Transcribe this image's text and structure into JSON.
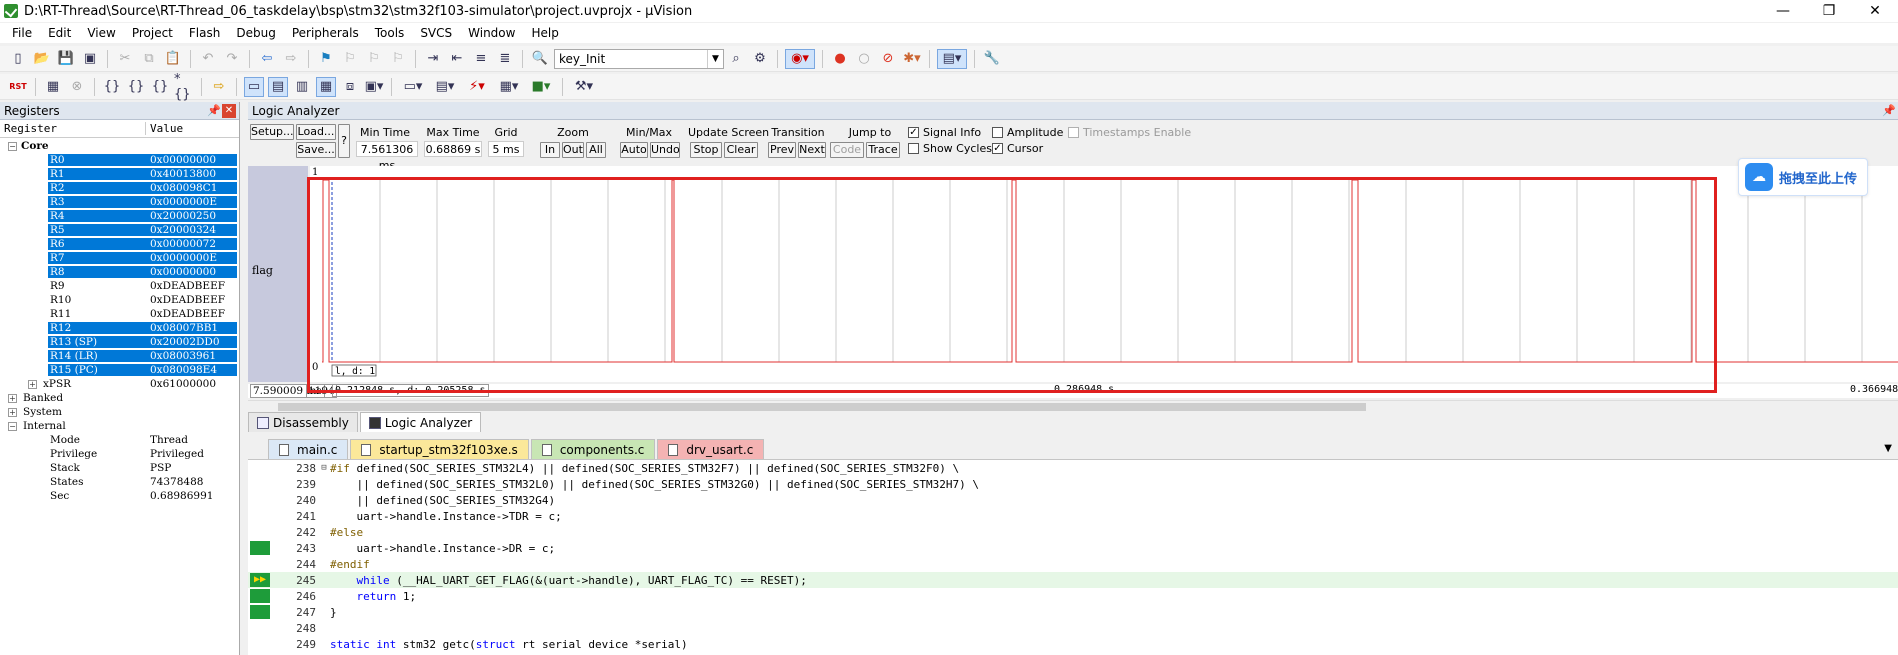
{
  "window": {
    "title": "D:\\RT-Thread\\Source\\RT-Thread_06_taskdelay\\bsp\\stm32\\stm32f103-simulator\\project.uvprojx - µVision",
    "min": "—",
    "max": "❐",
    "close": "✕"
  },
  "menu": [
    "File",
    "Edit",
    "View",
    "Project",
    "Flash",
    "Debug",
    "Peripherals",
    "Tools",
    "SVCS",
    "Window",
    "Help"
  ],
  "toolbar": {
    "target_combo": "key_Init"
  },
  "registers": {
    "title": "Registers",
    "col_register": "Register",
    "col_value": "Value",
    "core_label": "Core",
    "rows": [
      {
        "name": "R0",
        "value": "0x00000000",
        "sel": true
      },
      {
        "name": "R1",
        "value": "0x40013800",
        "sel": true
      },
      {
        "name": "R2",
        "value": "0x080098C1",
        "sel": true
      },
      {
        "name": "R3",
        "value": "0x0000000E",
        "sel": true
      },
      {
        "name": "R4",
        "value": "0x20000250",
        "sel": true
      },
      {
        "name": "R5",
        "value": "0x20000324",
        "sel": true
      },
      {
        "name": "R6",
        "value": "0x00000072",
        "sel": true
      },
      {
        "name": "R7",
        "value": "0x0000000E",
        "sel": true
      },
      {
        "name": "R8",
        "value": "0x00000000",
        "sel": true
      },
      {
        "name": "R9",
        "value": "0xDEADBEEF",
        "sel": false
      },
      {
        "name": "R10",
        "value": "0xDEADBEEF",
        "sel": false
      },
      {
        "name": "R11",
        "value": "0xDEADBEEF",
        "sel": false
      },
      {
        "name": "R12",
        "value": "0x08007BB1",
        "sel": true
      },
      {
        "name": "R13 (SP)",
        "value": "0x20002DD0",
        "sel": true
      },
      {
        "name": "R14 (LR)",
        "value": "0x08003961",
        "sel": true
      },
      {
        "name": "R15 (PC)",
        "value": "0x080098E4",
        "sel": true
      }
    ],
    "xpsr": {
      "name": "xPSR",
      "value": "0x61000000"
    },
    "groups": [
      "Banked",
      "System",
      "Internal"
    ],
    "internal": [
      {
        "name": "Mode",
        "value": "Thread"
      },
      {
        "name": "Privilege",
        "value": "Privileged"
      },
      {
        "name": "Stack",
        "value": "PSP"
      },
      {
        "name": "States",
        "value": "74378488"
      },
      {
        "name": "Sec",
        "value": "0.68986991"
      }
    ]
  },
  "logic_analyzer": {
    "title": "Logic Analyzer",
    "setup": "Setup...",
    "load": "Load...",
    "save": "Save...",
    "help": "?",
    "min_time_label": "Min Time",
    "min_time": "7.561306 ms",
    "max_time_label": "Max Time",
    "max_time": "0.68869 s",
    "grid_label": "Grid",
    "grid": "5 ms",
    "zoom_label": "Zoom",
    "zoom_in": "In",
    "zoom_out": "Out",
    "zoom_all": "All",
    "minmax_label": "Min/Max",
    "auto": "Auto",
    "undo": "Undo",
    "update_label": "Update Screen",
    "stop": "Stop",
    "clear": "Clear",
    "transition_label": "Transition",
    "prev": "Prev",
    "next": "Next",
    "jump_label": "Jump to",
    "code": "Code",
    "trace": "Trace",
    "signal_info": "Signal Info",
    "show_cycles": "Show Cycles",
    "amplitude": "Amplitude",
    "cursor": "Cursor",
    "timestamps": "Timestamps Enable",
    "signal_name": "flag",
    "y_high": "1",
    "y_low": "0",
    "cursor_label": "l, d: 1",
    "status_left": "7.590009 ms",
    "status_1194": "1194",
    "status_delta": "0.212848 s,  d: 0.205258 s",
    "status_mid": "0.286948 s",
    "status_right": "0.366948"
  },
  "upload_widget": {
    "label": "拖拽至此上传"
  },
  "bottom_tabs": [
    {
      "label": "Disassembly",
      "active": false
    },
    {
      "label": "Logic Analyzer",
      "active": true
    }
  ],
  "editor": {
    "tabs": [
      {
        "label": "main.c",
        "color": "#dbe8f6"
      },
      {
        "label": "startup_stm32f103xe.s",
        "color": "#fbe89a"
      },
      {
        "label": "components.c",
        "color": "#c8e6b4"
      },
      {
        "label": "drv_usart.c",
        "color": "#f4b3b3"
      }
    ],
    "lines": [
      {
        "n": "238",
        "mark": "",
        "fold": "⊟",
        "code": "#if defined(SOC_SERIES_STM32L4) || defined(SOC_SERIES_STM32F7) || defined(SOC_SERIES_STM32F0) \\"
      },
      {
        "n": "239",
        "mark": "",
        "fold": "",
        "code": "    || defined(SOC_SERIES_STM32L0) || defined(SOC_SERIES_STM32G0) || defined(SOC_SERIES_STM32H7) \\"
      },
      {
        "n": "240",
        "mark": "",
        "fold": "",
        "code": "    || defined(SOC_SERIES_STM32G4)"
      },
      {
        "n": "241",
        "mark": "",
        "fold": "",
        "code": "    uart->handle.Instance->TDR = c;"
      },
      {
        "n": "242",
        "mark": "",
        "fold": "",
        "code": "#else"
      },
      {
        "n": "243",
        "mark": "g",
        "fold": "",
        "code": "    uart->handle.Instance->DR = c;"
      },
      {
        "n": "244",
        "mark": "",
        "fold": "",
        "code": "#endif"
      },
      {
        "n": "245",
        "mark": "arrow",
        "fold": "",
        "code": "    while (__HAL_UART_GET_FLAG(&(uart->handle), UART_FLAG_TC) == RESET);"
      },
      {
        "n": "246",
        "mark": "g",
        "fold": "",
        "code": "    return 1;"
      },
      {
        "n": "247",
        "mark": "g",
        "fold": "",
        "code": "}"
      },
      {
        "n": "248",
        "mark": "",
        "fold": "",
        "code": ""
      },
      {
        "n": "249",
        "mark": "",
        "fold": "",
        "code": "static int stm32 getc(struct rt serial device *serial)"
      }
    ]
  }
}
